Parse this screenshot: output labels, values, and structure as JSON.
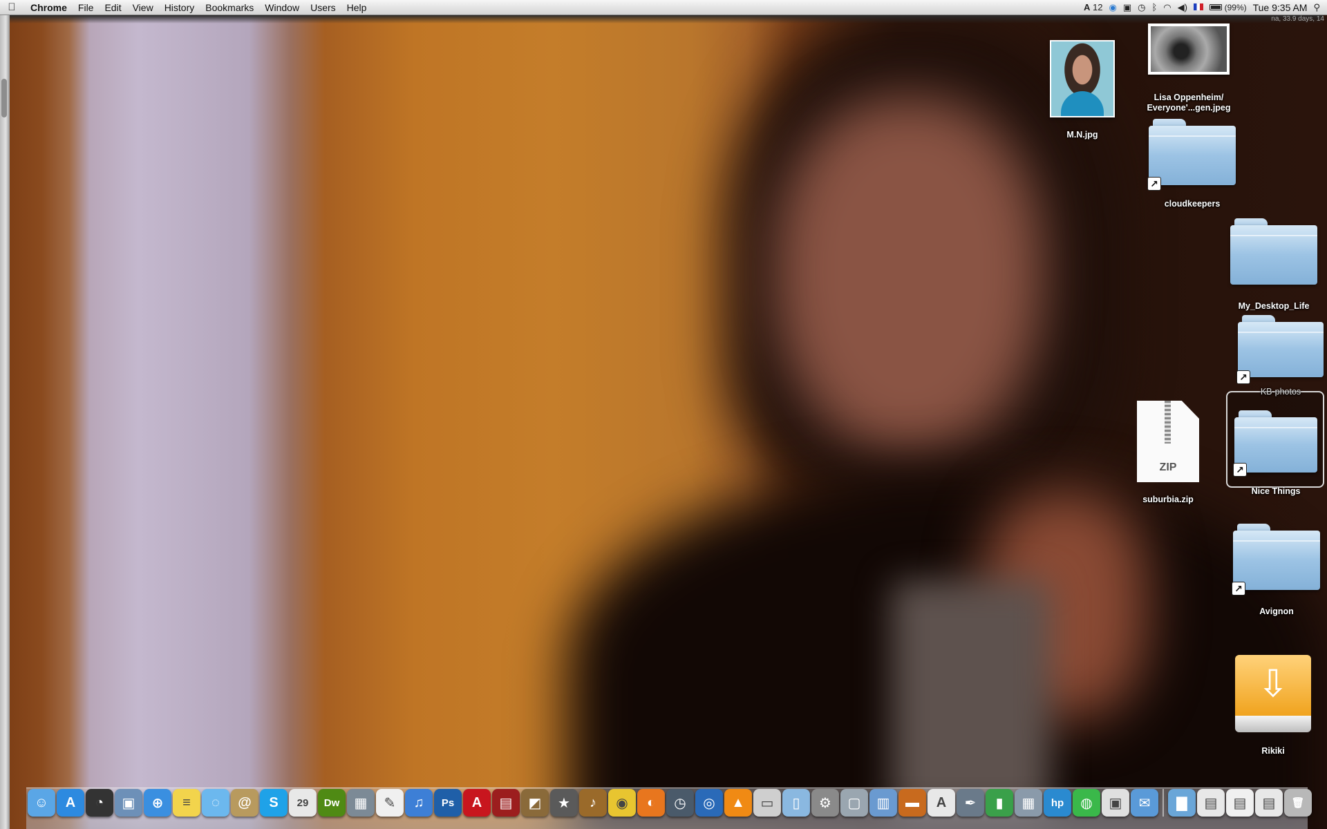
{
  "menubar": {
    "apple_icon": "apple-logo-icon",
    "app_name": "Chrome",
    "menus": [
      "File",
      "Edit",
      "View",
      "History",
      "Bookmarks",
      "Window",
      "Users",
      "Help"
    ],
    "status": {
      "text_size_indicator": "12",
      "battery_text": "(99%)",
      "clock": "Tue 9:35 AM"
    },
    "uptime_text": "na, 33.9 days, 14"
  },
  "desktop_icons": {
    "mn": {
      "label": "M.N.jpg"
    },
    "lisa": {
      "label_line1": "Lisa Oppenheim/",
      "label_line2": "Everyone'...gen.jpeg"
    },
    "cloudkeepers": {
      "label": "cloudkeepers"
    },
    "my_desktop_life": {
      "label": "My_Desktop_Life"
    },
    "kb_photos": {
      "label": "KB-photos"
    },
    "nice_things": {
      "label": "Nice Things"
    },
    "suburbia": {
      "label": "suburbia.zip",
      "badge": "ZIP"
    },
    "avignon": {
      "label": "Avignon"
    },
    "rikiki": {
      "label": "Rikiki"
    }
  },
  "dock": {
    "apps": [
      {
        "name": "finder",
        "color": "#5aa6e6",
        "glyph": "☺"
      },
      {
        "name": "app-store",
        "color": "#2d8ae0",
        "glyph": "A"
      },
      {
        "name": "dashboard",
        "color": "#333333",
        "glyph": "◔"
      },
      {
        "name": "preview",
        "color": "#6d90b8",
        "glyph": "▣"
      },
      {
        "name": "safari",
        "color": "#3a8fe0",
        "glyph": "⊕"
      },
      {
        "name": "stickies",
        "color": "#f2d44c",
        "glyph": "≡"
      },
      {
        "name": "ichat",
        "color": "#6cb8ee",
        "glyph": "◌"
      },
      {
        "name": "address-book",
        "color": "#b89a5e",
        "glyph": "@"
      },
      {
        "name": "skype",
        "color": "#1fa2e8",
        "glyph": "S"
      },
      {
        "name": "ical",
        "color": "#e8e8e8",
        "glyph": "29"
      },
      {
        "name": "dreamweaver",
        "color": "#4f8a14",
        "glyph": "Dw"
      },
      {
        "name": "iphoto-library",
        "color": "#7c8a96",
        "glyph": "▦"
      },
      {
        "name": "textedit",
        "color": "#f0f0f0",
        "glyph": "✎"
      },
      {
        "name": "itunes",
        "color": "#3d7fd6",
        "glyph": "♫"
      },
      {
        "name": "photoshop",
        "color": "#1f5fa8",
        "glyph": "Ps"
      },
      {
        "name": "acrobat",
        "color": "#c8161e",
        "glyph": "A"
      },
      {
        "name": "photo-booth",
        "color": "#9c1e1e",
        "glyph": "▤"
      },
      {
        "name": "iphoto",
        "color": "#8a6a3a",
        "glyph": "◩"
      },
      {
        "name": "imovie",
        "color": "#5a5a5a",
        "glyph": "★"
      },
      {
        "name": "garageband",
        "color": "#9a6a2a",
        "glyph": "♪"
      },
      {
        "name": "chrome",
        "color": "#e8c530",
        "glyph": "◉"
      },
      {
        "name": "firefox",
        "color": "#e8761e",
        "glyph": "◐"
      },
      {
        "name": "time-machine",
        "color": "#4a5a6a",
        "glyph": "◷"
      },
      {
        "name": "dvd-player",
        "color": "#2a6ab8",
        "glyph": "◎"
      },
      {
        "name": "vlc",
        "color": "#f08a14",
        "glyph": "▲"
      },
      {
        "name": "disk-utility",
        "color": "#cfcfcf",
        "glyph": "▭"
      },
      {
        "name": "documents",
        "color": "#8ab8e0",
        "glyph": "▯"
      },
      {
        "name": "system-preferences",
        "color": "#8a8a8a",
        "glyph": "⚙"
      },
      {
        "name": "image-capture",
        "color": "#9aa6b0",
        "glyph": "▢"
      },
      {
        "name": "screen-sharing",
        "color": "#6a9ad0",
        "glyph": "▥"
      },
      {
        "name": "keynote",
        "color": "#c86a1e",
        "glyph": "▬"
      },
      {
        "name": "adobe-reader",
        "color": "#e8e8e8",
        "glyph": "A"
      },
      {
        "name": "script-editor",
        "color": "#6a7a8a",
        "glyph": "✒"
      },
      {
        "name": "numbers",
        "color": "#3aa04a",
        "glyph": "▮"
      },
      {
        "name": "network-utility",
        "color": "#8a9aaa",
        "glyph": "▦"
      },
      {
        "name": "hp-utility",
        "color": "#2a8ad0",
        "glyph": "hp"
      },
      {
        "name": "cyberduck",
        "color": "#3ab84a",
        "glyph": "◍"
      },
      {
        "name": "calendar-sync",
        "color": "#e0e0e0",
        "glyph": "▣"
      },
      {
        "name": "apple-mail",
        "color": "#5a9ad8",
        "glyph": "✉"
      }
    ],
    "stacks": [
      {
        "name": "applications-stack",
        "color": "#6aa6d8",
        "glyph": "▇"
      },
      {
        "name": "documents-stack",
        "color": "#e8e8e8",
        "glyph": "▤"
      },
      {
        "name": "pdf-stack",
        "color": "#f0f0f0",
        "glyph": "▤"
      },
      {
        "name": "downloads-stack",
        "color": "#e8e8e8",
        "glyph": "▤"
      },
      {
        "name": "trash",
        "color": "#b8b8b8",
        "glyph": "🗑"
      }
    ]
  }
}
